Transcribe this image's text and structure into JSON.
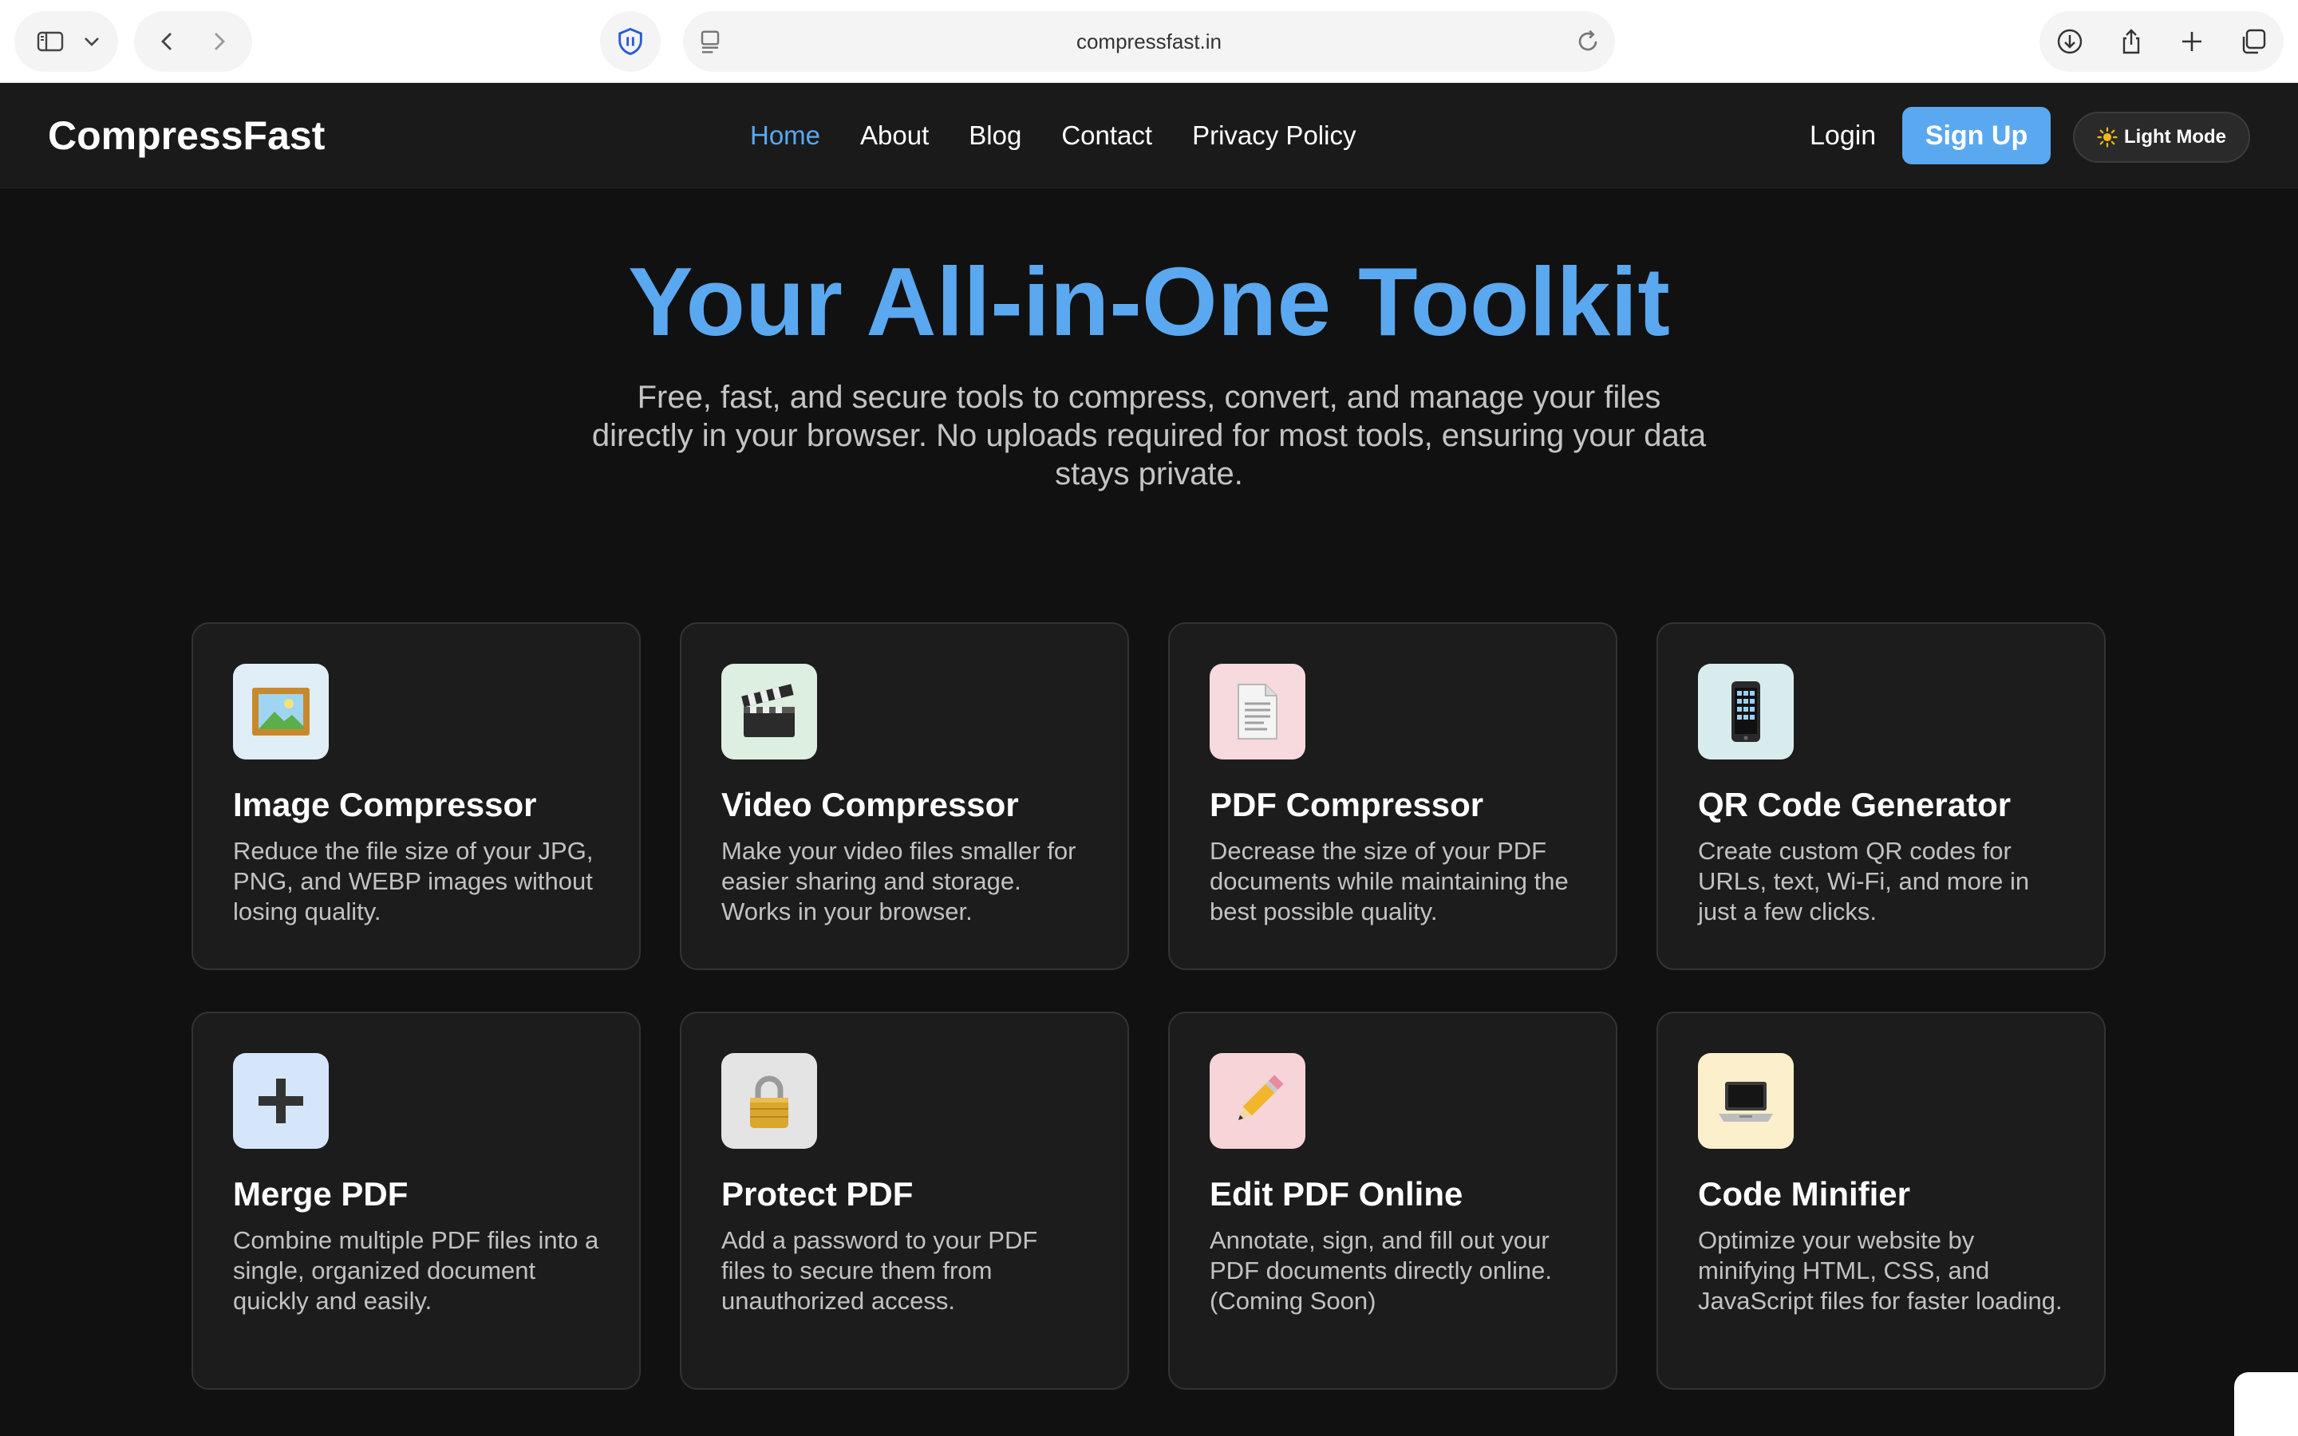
{
  "browser": {
    "url": "compressfast.in"
  },
  "site": {
    "logo": "CompressFast",
    "nav": [
      "Home",
      "About",
      "Blog",
      "Contact",
      "Privacy Policy"
    ],
    "active_nav": "Home",
    "login_label": "Login",
    "signup_label": "Sign Up",
    "theme_toggle_label": "Light Mode",
    "accent_color": "#5aa8f0"
  },
  "hero": {
    "title": "Your All-in-One Toolkit",
    "subtitle": "Free, fast, and secure tools to compress, convert, and manage your files directly in your browser. No uploads required for most tools, ensuring your data stays private."
  },
  "tools": [
    {
      "icon": "framed-picture-icon",
      "title": "Image Compressor",
      "description": "Reduce the file size of your JPG, PNG, and WEBP images without losing quality."
    },
    {
      "icon": "clapperboard-icon",
      "title": "Video Compressor",
      "description": "Make your video files smaller for easier sharing and storage. Works in your browser."
    },
    {
      "icon": "document-icon",
      "title": "PDF Compressor",
      "description": "Decrease the size of your PDF documents while maintaining the best possible quality."
    },
    {
      "icon": "mobile-phone-icon",
      "title": "QR Code Generator",
      "description": "Create custom QR codes for URLs, text, Wi-Fi, and more in just a few clicks."
    },
    {
      "icon": "plus-icon",
      "title": "Merge PDF",
      "description": "Combine multiple PDF files into a single, organized document quickly and easily."
    },
    {
      "icon": "padlock-icon",
      "title": "Protect PDF",
      "description": "Add a password to your PDF files to secure them from unauthorized access."
    },
    {
      "icon": "pencil-icon",
      "title": "Edit PDF Online",
      "description": "Annotate, sign, and fill out your PDF documents directly online. (Coming Soon)"
    },
    {
      "icon": "laptop-icon",
      "title": "Code Minifier",
      "description": "Optimize your website by minifying HTML, CSS, and JavaScript files for faster loading."
    }
  ]
}
